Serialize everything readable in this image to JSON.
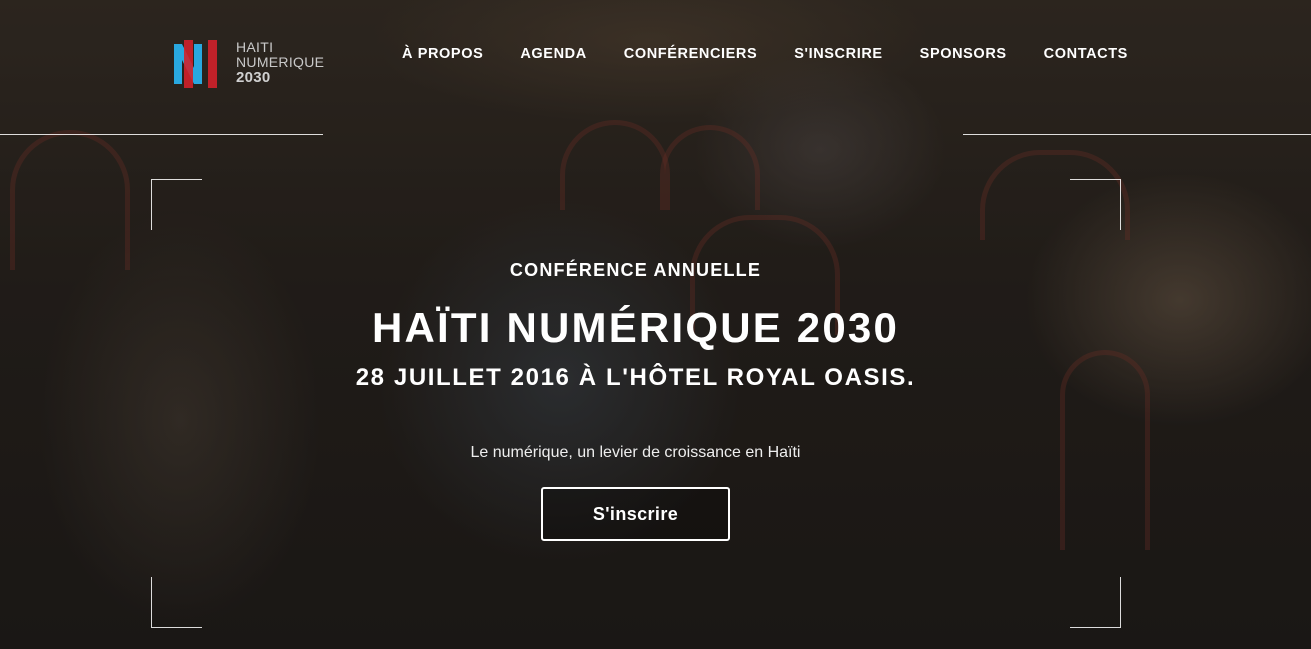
{
  "header": {
    "logo": {
      "line1": "HAITI",
      "line2": "NUMERIQUE",
      "line3": "2030"
    },
    "nav": [
      {
        "label": "À PROPOS"
      },
      {
        "label": "AGENDA"
      },
      {
        "label": "CONFÉRENCIERS"
      },
      {
        "label": "S'INSCRIRE"
      },
      {
        "label": "SPONSORS"
      },
      {
        "label": "CONTACTS"
      }
    ]
  },
  "hero": {
    "kicker": "CONFÉRENCE ANNUELLE",
    "title": "HAÏTI NUMÉRIQUE 2030",
    "subtitle": "28 JUILLET 2016 À L'HÔTEL ROYAL OASIS.",
    "tagline": "Le numérique, un levier de croissance en Haïti",
    "cta_label": "S'inscrire"
  },
  "colors": {
    "logo_red": "#d0212b",
    "logo_blue": "#29a8e0",
    "text": "#ffffff"
  }
}
